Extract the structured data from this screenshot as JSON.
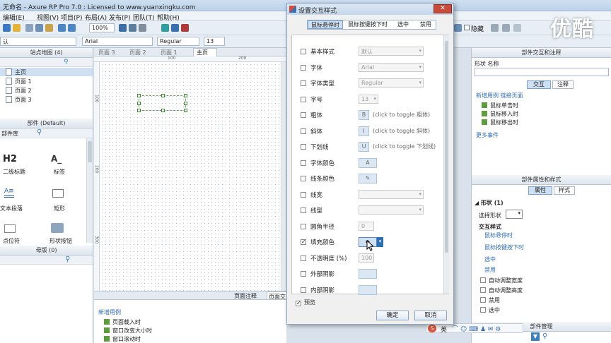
{
  "app": {
    "title": "无命名 - Axure RP Pro 7.0 : Licensed to www.yuanxingku.com",
    "watermark": "优酷"
  },
  "menu": [
    "编辑(E)",
    "视图(V)",
    "项目(P)",
    "布局(A)",
    "发布(P)",
    "团队(T)",
    "帮助(H)"
  ],
  "toolbar": {
    "zoom": "100%",
    "font": "Arial",
    "style": "Regular",
    "size": "13",
    "hide_label": "隐藏",
    "left_field": "认"
  },
  "left": {
    "sitemap_header": "站点地图 (4)",
    "pages": [
      "主页",
      "页面 1",
      "页面 2",
      "页面 3"
    ],
    "widgets_header": "部件 (Default)",
    "library_label": "部件库",
    "widgets": [
      "H2",
      "A_",
      "二级标题",
      "标签",
      "文本段落",
      "矩形",
      "点位符",
      "形状按钮"
    ],
    "masters_header": "母版 (0)"
  },
  "canvas": {
    "tabs": [
      "页面 3",
      "页面 2",
      "页面 1",
      "主页"
    ],
    "ruler_marks": [
      "100",
      "200",
      "300"
    ]
  },
  "bottom": {
    "tabs": [
      "页面注释",
      "页面交"
    ],
    "new_case": "新增用例",
    "events": [
      "页面载入时",
      "窗口改变大小时",
      "窗口滚动时"
    ]
  },
  "dialog": {
    "title": "设置交互样式",
    "close": "✕",
    "tabs": [
      "鼠标悬停时",
      "鼠标按键按下时",
      "选中",
      "禁用"
    ],
    "rows": [
      {
        "label": "基本样式",
        "value": "默认",
        "kind": "select",
        "checked": false
      },
      {
        "label": "字体",
        "value": "Arial",
        "kind": "select",
        "checked": false
      },
      {
        "label": "字体类型",
        "value": "Regular",
        "kind": "select",
        "checked": false
      },
      {
        "label": "字号",
        "value": "13",
        "kind": "select",
        "checked": false
      },
      {
        "label": "粗体",
        "value": "(click to toggle 粗体)",
        "glyph": "B",
        "kind": "toggle",
        "checked": false
      },
      {
        "label": "斜体",
        "value": "(click to toggle 斜体)",
        "glyph": "I",
        "kind": "toggle",
        "checked": false
      },
      {
        "label": "下划线",
        "value": "(click to toggle 下划线)",
        "glyph": "U",
        "kind": "toggle",
        "checked": false
      },
      {
        "label": "字体颜色",
        "value": "A",
        "kind": "color",
        "checked": false
      },
      {
        "label": "线条颜色",
        "value": "✎",
        "kind": "color",
        "checked": false
      },
      {
        "label": "线宽",
        "value": "",
        "kind": "select",
        "checked": false
      },
      {
        "label": "线型",
        "value": "",
        "kind": "select",
        "checked": false
      },
      {
        "label": "圆角半径",
        "value": "0",
        "kind": "number",
        "checked": false
      },
      {
        "label": "填充颜色",
        "value": "◆",
        "kind": "color",
        "checked": true
      },
      {
        "label": "不透明度 (%)",
        "value": "100",
        "kind": "number",
        "checked": false
      },
      {
        "label": "外部阴影",
        "value": "",
        "kind": "color",
        "checked": false
      },
      {
        "label": "内部阴影",
        "value": "",
        "kind": "color",
        "checked": false
      }
    ],
    "preview": "预览",
    "ok": "确定",
    "cancel": "取消"
  },
  "right": {
    "interaction_header": "部件交互和注释",
    "shape_name_label": "形状 名称",
    "tabs1": [
      "交互",
      "注释"
    ],
    "new_case": "新增用例",
    "link_page": "链接页面",
    "events": [
      "鼠标单击时",
      "鼠标移入时",
      "鼠标移出时"
    ],
    "more_events": "更多事件",
    "props_header": "部件属性和样式",
    "tabs2": [
      "属性",
      "样式"
    ],
    "shape_count": "形状 (1)",
    "select_shape": "选择形状",
    "interaction_styles": "交互样式",
    "style_links": [
      "鼠标悬停时",
      "鼠标按键按下时",
      "选中",
      "禁用"
    ],
    "checks": [
      "自动调整宽度",
      "自动调整高度",
      "禁用",
      "选中"
    ],
    "manager": "部件管理"
  },
  "ime": {
    "label": "英"
  }
}
